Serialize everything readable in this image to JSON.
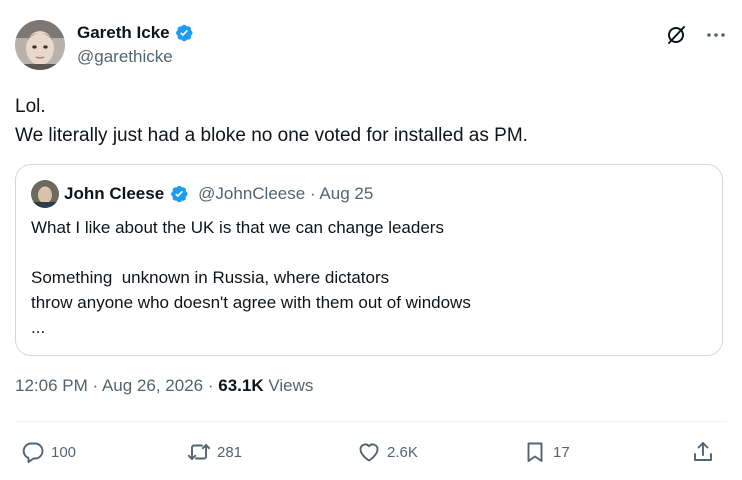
{
  "author": {
    "display_name": "Gareth Icke",
    "handle": "@garethicke"
  },
  "tweet": {
    "lines": [
      "Lol.",
      "We literally just had a bloke no one voted for installed as PM."
    ]
  },
  "quoted": {
    "display_name": "John Cleese",
    "handle": "@JohnCleese",
    "separator": "·",
    "date": "Aug 25",
    "lines": [
      "What I like about the UK is that we can change leaders",
      "",
      "Something  unknown in Russia, where dictators",
      "throw anyone who doesn't agree with them out of windows",
      "..."
    ]
  },
  "meta": {
    "time": "12:06 PM",
    "sep1": "·",
    "date": "Aug 26, 2026",
    "sep2": "·",
    "views_count": "63.1K",
    "views_label": "Views"
  },
  "actions": {
    "replies": "100",
    "retweets": "281",
    "likes": "2.6K",
    "bookmarks": "17"
  },
  "colors": {
    "verified": "#1d9bf0",
    "text": "#0f1419",
    "secondary": "#536471",
    "border": "#cfd9de"
  },
  "icons": [
    "verified-badge-icon",
    "grok-icon",
    "more-icon",
    "reply-icon",
    "retweet-icon",
    "like-icon",
    "bookmark-icon",
    "share-icon"
  ]
}
